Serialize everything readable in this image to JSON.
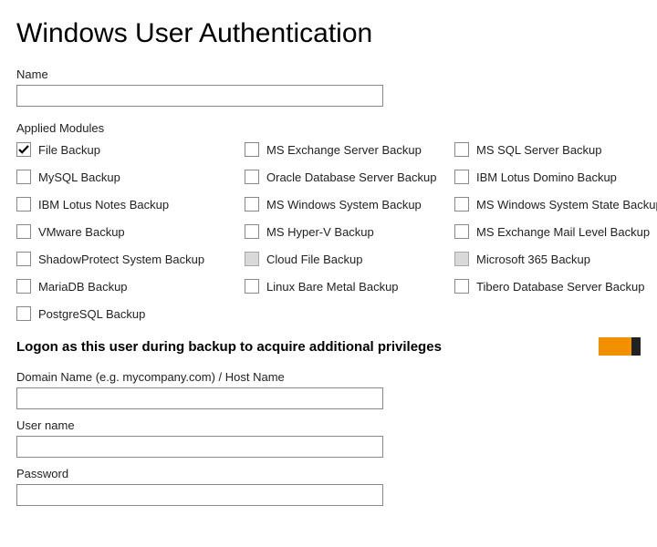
{
  "title": "Windows User Authentication",
  "name_label": "Name",
  "name_value": "",
  "modules_label": "Applied Modules",
  "modules": [
    {
      "label": "File Backup",
      "checked": true,
      "disabled": false
    },
    {
      "label": "MS Exchange Server Backup",
      "checked": false,
      "disabled": false
    },
    {
      "label": "MS SQL Server Backup",
      "checked": false,
      "disabled": false
    },
    {
      "label": "MySQL Backup",
      "checked": false,
      "disabled": false
    },
    {
      "label": "Oracle Database Server Backup",
      "checked": false,
      "disabled": false
    },
    {
      "label": "IBM Lotus Domino Backup",
      "checked": false,
      "disabled": false
    },
    {
      "label": "IBM Lotus Notes Backup",
      "checked": false,
      "disabled": false
    },
    {
      "label": "MS Windows System Backup",
      "checked": false,
      "disabled": false
    },
    {
      "label": "MS Windows System State Backup",
      "checked": false,
      "disabled": false
    },
    {
      "label": "VMware Backup",
      "checked": false,
      "disabled": false
    },
    {
      "label": "MS Hyper-V Backup",
      "checked": false,
      "disabled": false
    },
    {
      "label": "MS Exchange Mail Level Backup",
      "checked": false,
      "disabled": false
    },
    {
      "label": "ShadowProtect System Backup",
      "checked": false,
      "disabled": false
    },
    {
      "label": "Cloud File Backup",
      "checked": false,
      "disabled": true
    },
    {
      "label": "Microsoft 365 Backup",
      "checked": false,
      "disabled": true
    },
    {
      "label": "MariaDB Backup",
      "checked": false,
      "disabled": false
    },
    {
      "label": "Linux Bare Metal Backup",
      "checked": false,
      "disabled": false
    },
    {
      "label": "Tibero Database Server Backup",
      "checked": false,
      "disabled": false
    },
    {
      "label": "PostgreSQL Backup",
      "checked": false,
      "disabled": false
    }
  ],
  "logon_label": "Logon as this user during backup to acquire additional privileges",
  "logon_toggle_on": true,
  "domain_label": "Domain Name (e.g. mycompany.com) / Host Name",
  "domain_value": "",
  "username_label": "User name",
  "username_value": "",
  "password_label": "Password",
  "password_value": ""
}
